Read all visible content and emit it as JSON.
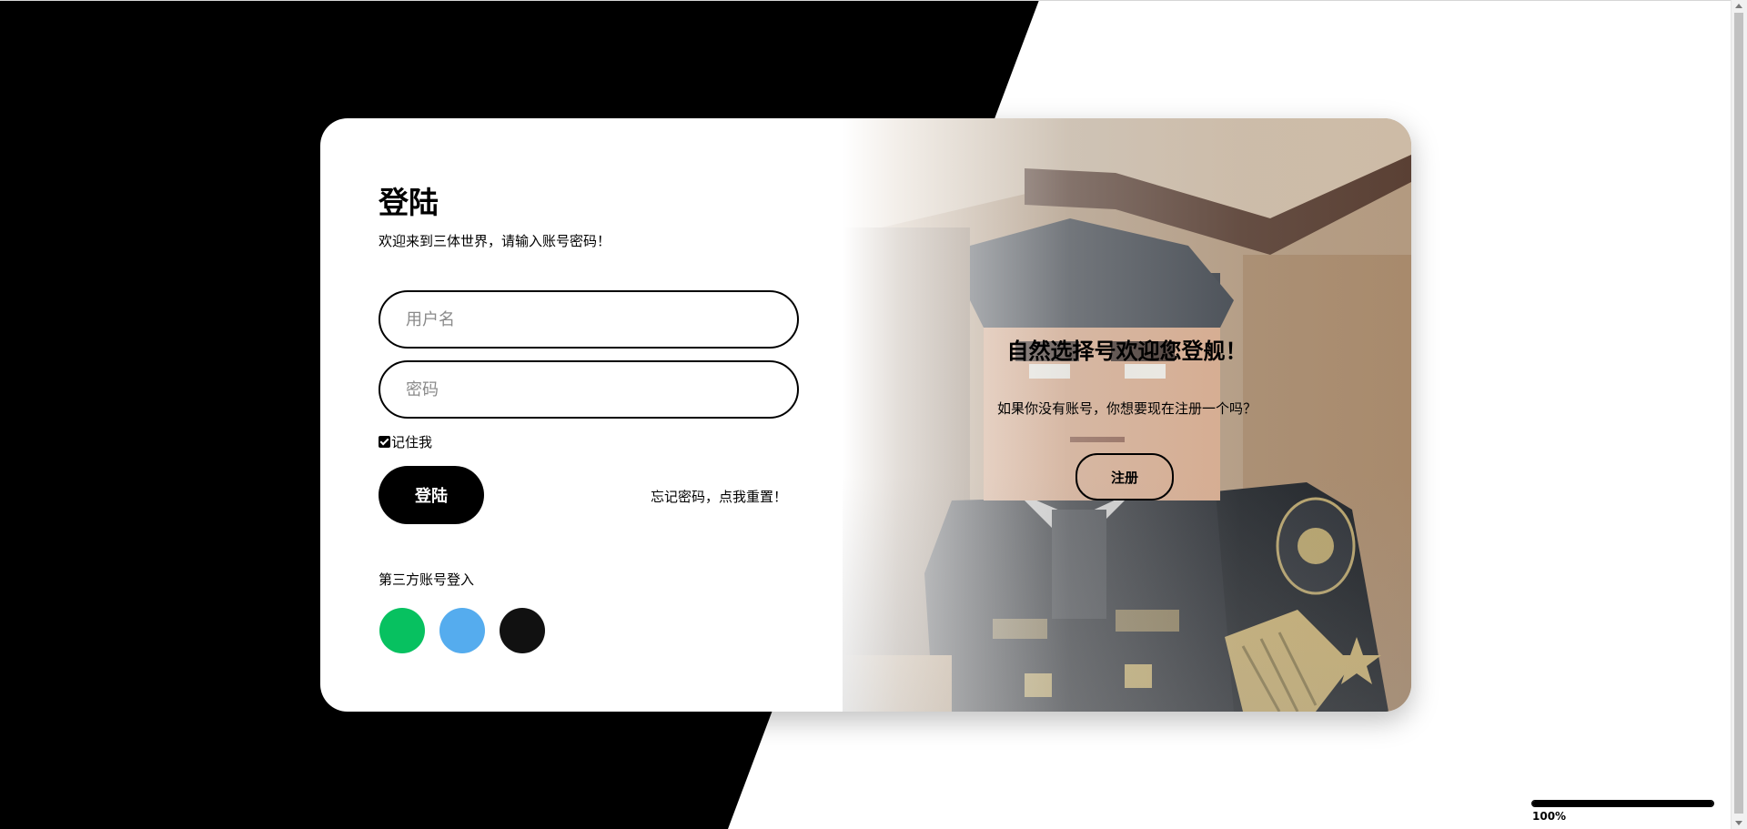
{
  "login": {
    "title": "登陆",
    "subtitle": "欢迎来到三体世界，请输入账号密码！",
    "username_placeholder": "用户名",
    "password_placeholder": "密码",
    "remember_label": "记住我",
    "remember_checked": true,
    "login_button": "登陆",
    "forgot_link": "忘记密码，点我重置！",
    "third_party_label": "第三方账号登入",
    "social_buttons": [
      {
        "icon": "wechat-icon",
        "color": "#07c160"
      },
      {
        "icon": "qq-icon",
        "color": "#55acee"
      },
      {
        "icon": "github-icon",
        "color": "#111111"
      }
    ]
  },
  "promo": {
    "welcome": "自然选择号欢迎您登舰！",
    "question": "如果你没有账号，你想要现在注册一个吗？",
    "register_button": "注册"
  },
  "loading": {
    "percent": 100,
    "label": "100%"
  }
}
